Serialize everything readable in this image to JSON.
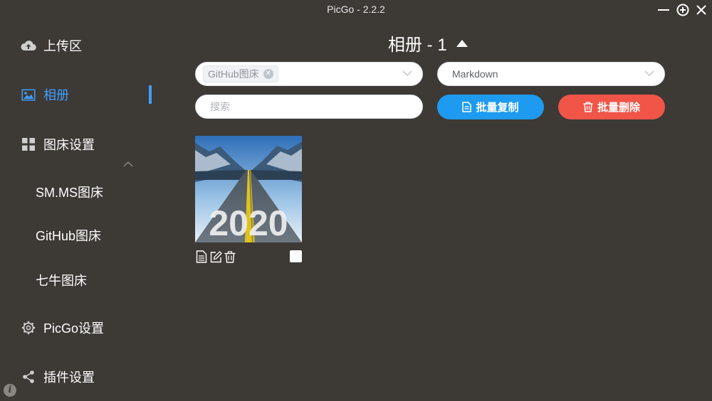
{
  "window": {
    "title": "PicGo - 2.2.2"
  },
  "sidebar": {
    "items": [
      {
        "label": "上传区",
        "icon": "cloud-upload-icon"
      },
      {
        "label": "相册",
        "icon": "image-icon",
        "active": true
      },
      {
        "label": "图床设置",
        "icon": "grid-icon"
      },
      {
        "label": "SM.MS图床"
      },
      {
        "label": "GitHub图床"
      },
      {
        "label": "七牛图床"
      },
      {
        "label": "PicGo设置",
        "icon": "gear-icon"
      },
      {
        "label": "插件设置",
        "icon": "share-icon"
      }
    ],
    "active_color": "#409eff"
  },
  "gallery": {
    "title": "相册 - 1",
    "picbed_filter": {
      "selected_tag": "GitHub图床"
    },
    "format_select": {
      "value": "Markdown"
    },
    "search": {
      "placeholder": "搜索"
    },
    "buttons": {
      "copy_label": "批量复制",
      "delete_label": "批量删除"
    },
    "colors": {
      "copy": "#1e9bf0",
      "delete": "#f05548",
      "background": "#3d3935"
    },
    "images": [
      {
        "overlay_text": "2020",
        "checked": false
      }
    ]
  }
}
